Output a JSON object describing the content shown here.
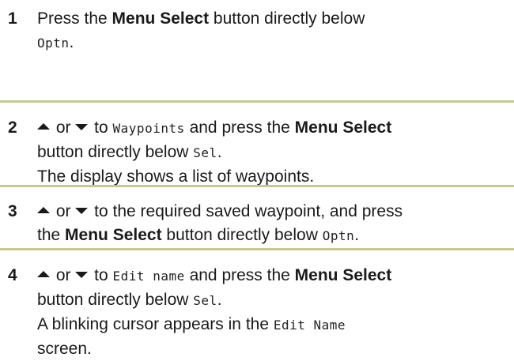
{
  "steps": [
    {
      "number": "1",
      "lines": [
        [
          {
            "t": "text",
            "v": "Press the "
          },
          {
            "t": "bold",
            "v": "Menu Select"
          },
          {
            "t": "text",
            "v": " button directly below"
          }
        ],
        [
          {
            "t": "lcd",
            "v": "Optn"
          },
          {
            "t": "text",
            "v": "."
          }
        ]
      ]
    },
    {
      "number": "2",
      "lines": [
        [
          {
            "t": "icon",
            "v": "up"
          },
          {
            "t": "text",
            "v": " or "
          },
          {
            "t": "icon",
            "v": "down"
          },
          {
            "t": "text",
            "v": " to "
          },
          {
            "t": "lcd",
            "v": "Waypoints"
          },
          {
            "t": "text",
            "v": " and press the "
          },
          {
            "t": "bold",
            "v": "Menu Select"
          }
        ],
        [
          {
            "t": "text",
            "v": "button directly below "
          },
          {
            "t": "lcd",
            "v": "Sel"
          },
          {
            "t": "text",
            "v": "."
          }
        ],
        [
          {
            "t": "text",
            "v": "The display shows a list of waypoints."
          }
        ]
      ]
    },
    {
      "number": "3",
      "lines": [
        [
          {
            "t": "icon",
            "v": "up"
          },
          {
            "t": "text",
            "v": " or "
          },
          {
            "t": "icon",
            "v": "down"
          },
          {
            "t": "text",
            "v": " to the required saved waypoint, and press"
          }
        ],
        [
          {
            "t": "text",
            "v": "the "
          },
          {
            "t": "bold",
            "v": "Menu Select"
          },
          {
            "t": "text",
            "v": " button directly below "
          },
          {
            "t": "lcd",
            "v": "Optn"
          },
          {
            "t": "text",
            "v": "."
          }
        ]
      ]
    },
    {
      "number": "4",
      "lines": [
        [
          {
            "t": "icon",
            "v": "up"
          },
          {
            "t": "text",
            "v": " or "
          },
          {
            "t": "icon",
            "v": "down"
          },
          {
            "t": "text",
            "v": " to "
          },
          {
            "t": "lcd",
            "v": "Edit name"
          },
          {
            "t": "text",
            "v": " and press the "
          },
          {
            "t": "bold",
            "v": "Menu Select"
          }
        ],
        [
          {
            "t": "text",
            "v": "button directly below "
          },
          {
            "t": "lcd",
            "v": "Sel"
          },
          {
            "t": "text",
            "v": "."
          }
        ],
        [
          {
            "t": "text",
            "v": "A blinking cursor appears in the "
          },
          {
            "t": "lcd",
            "v": "Edit Name"
          }
        ],
        [
          {
            "t": "text",
            "v": "screen."
          }
        ]
      ]
    }
  ],
  "colors": {
    "divider": "#c8c890",
    "text": "#1a1a1a"
  }
}
